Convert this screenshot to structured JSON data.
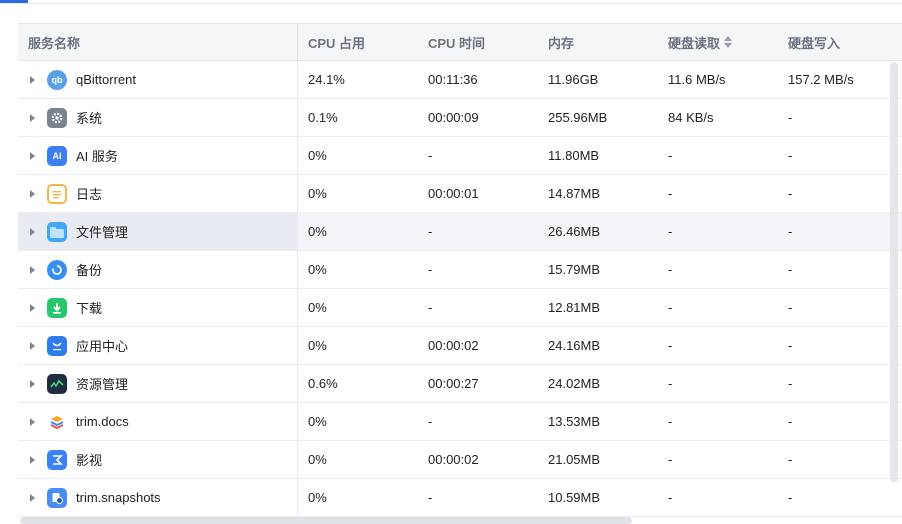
{
  "header": {
    "service_name": "服务名称",
    "cpu_usage": "CPU 占用",
    "cpu_time": "CPU 时间",
    "memory": "内存",
    "disk_read": "硬盘读取",
    "disk_write": "硬盘写入"
  },
  "rows": [
    {
      "name": "qBittorrent",
      "icon": "qbittorrent-icon",
      "cpu": "24.1%",
      "time": "00:11:36",
      "mem": "11.96GB",
      "read": "11.6 MB/s",
      "write": "157.2 MB/s"
    },
    {
      "name": "系统",
      "icon": "system-gear-icon",
      "cpu": "0.1%",
      "time": "00:00:09",
      "mem": "255.96MB",
      "read": "84 KB/s",
      "write": "-"
    },
    {
      "name": "AI 服务",
      "icon": "ai-icon",
      "cpu": "0%",
      "time": "-",
      "mem": "11.80MB",
      "read": "-",
      "write": "-"
    },
    {
      "name": "日志",
      "icon": "log-icon",
      "cpu": "0%",
      "time": "00:00:01",
      "mem": "14.87MB",
      "read": "-",
      "write": "-"
    },
    {
      "name": "文件管理",
      "icon": "folder-icon",
      "cpu": "0%",
      "time": "-",
      "mem": "26.46MB",
      "read": "-",
      "write": "-"
    },
    {
      "name": "备份",
      "icon": "backup-icon",
      "cpu": "0%",
      "time": "-",
      "mem": "15.79MB",
      "read": "-",
      "write": "-"
    },
    {
      "name": "下载",
      "icon": "download-icon",
      "cpu": "0%",
      "time": "-",
      "mem": "12.81MB",
      "read": "-",
      "write": "-"
    },
    {
      "name": "应用中心",
      "icon": "app-center-icon",
      "cpu": "0%",
      "time": "00:00:02",
      "mem": "24.16MB",
      "read": "-",
      "write": "-"
    },
    {
      "name": "资源管理",
      "icon": "resource-monitor-icon",
      "cpu": "0.6%",
      "time": "00:00:27",
      "mem": "24.02MB",
      "read": "-",
      "write": "-"
    },
    {
      "name": "trim.docs",
      "icon": "docs-stack-icon",
      "cpu": "0%",
      "time": "-",
      "mem": "13.53MB",
      "read": "-",
      "write": "-"
    },
    {
      "name": "影视",
      "icon": "video-icon",
      "cpu": "0%",
      "time": "00:00:02",
      "mem": "21.05MB",
      "read": "-",
      "write": "-"
    },
    {
      "name": "trim.snapshots",
      "icon": "snapshot-icon",
      "cpu": "0%",
      "time": "-",
      "mem": "10.59MB",
      "read": "-",
      "write": "-"
    }
  ],
  "icon_glyphs": {
    "qb": "qb",
    "ai": "AI"
  },
  "colors": {
    "accent": "#2d6ae0",
    "highlight_row": "#f3f5f9"
  }
}
